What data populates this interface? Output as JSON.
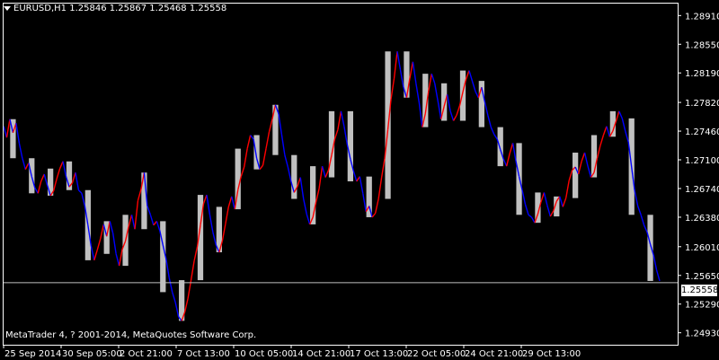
{
  "header": {
    "symbol": "EURUSD,H1",
    "open": "1.25846",
    "high": "1.25867",
    "low": "1.25468",
    "close": "1.25558"
  },
  "copyright": "MetaTrader 4, ? 2001-2014, MetaQuotes Software Corp.",
  "current_price_label": "1.25558",
  "colors": {
    "background": "#000000",
    "frame": "#ffffff",
    "bull_bar": "#ff0000",
    "bear_bar": "#0000ff",
    "bg_box": "#c0c0c0",
    "price_line": "#c0c0c0"
  },
  "chart_data": {
    "type": "line",
    "title": "EURUSD,H1",
    "y_ticks": [
      "1.28910",
      "1.28550",
      "1.28190",
      "1.27820",
      "1.27460",
      "1.27100",
      "1.26740",
      "1.26380",
      "1.26010",
      "1.25650",
      "1.25290",
      "1.24930"
    ],
    "x_ticks": [
      "25 Sep 2014",
      "30 Sep 05:00",
      "2 Oct 21:00",
      "7 Oct 13:00",
      "10 Oct 05:00",
      "14 Oct 21:00",
      "17 Oct 13:00",
      "22 Oct 05:00",
      "24 Oct 21:00",
      "29 Oct 13:00"
    ],
    "ylim": [
      1.2478,
      1.2906
    ],
    "current_price": 1.25558,
    "series": [
      {
        "values": [
          1.2752,
          1.2738,
          1.2761,
          1.2744,
          1.2756,
          1.2731,
          1.2712,
          1.2698,
          1.2706,
          1.2689,
          1.2675,
          1.2668,
          1.2683,
          1.2692,
          1.2678,
          1.2665,
          1.2671,
          1.2686,
          1.2699,
          1.2708,
          1.2689,
          1.2676,
          1.2681,
          1.2694,
          1.2672,
          1.2668,
          1.2652,
          1.2628,
          1.2602,
          1.2584,
          1.2597,
          1.2611,
          1.2629,
          1.2614,
          1.2633,
          1.2618,
          1.2592,
          1.2577,
          1.2598,
          1.2608,
          1.2626,
          1.2641,
          1.2623,
          1.2659,
          1.2673,
          1.2694,
          1.2652,
          1.2641,
          1.2628,
          1.2633,
          1.2621,
          1.2603,
          1.2586,
          1.2562,
          1.2544,
          1.2531,
          1.2513,
          1.2508,
          1.2519,
          1.2536,
          1.2559,
          1.2583,
          1.2601,
          1.2628,
          1.2655,
          1.2666,
          1.2641,
          1.2619,
          1.2603,
          1.2594,
          1.2608,
          1.2629,
          1.2651,
          1.2664,
          1.2648,
          1.2672,
          1.2689,
          1.2701,
          1.2724,
          1.2741,
          1.2736,
          1.2712,
          1.2698,
          1.2703,
          1.2724,
          1.2745,
          1.2761,
          1.2779,
          1.2768,
          1.2742,
          1.2716,
          1.2701,
          1.2683,
          1.2669,
          1.2676,
          1.2688,
          1.2661,
          1.2642,
          1.2629,
          1.2638,
          1.2657,
          1.2674,
          1.2702,
          1.2688,
          1.2697,
          1.2716,
          1.2736,
          1.2748,
          1.2771,
          1.2752,
          1.2729,
          1.2711,
          1.2696,
          1.2683,
          1.2689,
          1.2668,
          1.2645,
          1.2652,
          1.2638,
          1.2643,
          1.2661,
          1.2688,
          1.2712,
          1.2748,
          1.2786,
          1.2812,
          1.2846,
          1.2823,
          1.2801,
          1.2788,
          1.2812,
          1.2833,
          1.2806,
          1.2782,
          1.2751,
          1.2768,
          1.2796,
          1.2818,
          1.2806,
          1.2784,
          1.2761,
          1.2777,
          1.2792,
          1.2771,
          1.2759,
          1.2766,
          1.2778,
          1.2795,
          1.2811,
          1.2822,
          1.2809,
          1.2796,
          1.2788,
          1.2801,
          1.2783,
          1.2766,
          1.2751,
          1.2742,
          1.2736,
          1.2723,
          1.2711,
          1.2702,
          1.2718,
          1.2731,
          1.2708,
          1.2689,
          1.2672,
          1.2654,
          1.2641,
          1.2638,
          1.2631,
          1.2642,
          1.2657,
          1.2669,
          1.2653,
          1.2639,
          1.2646,
          1.2658,
          1.2664,
          1.2651,
          1.2662,
          1.2684,
          1.2697,
          1.2701,
          1.2692,
          1.2708,
          1.2719,
          1.2702,
          1.2688,
          1.2694,
          1.2712,
          1.2728,
          1.2741,
          1.2752,
          1.2739,
          1.2746,
          1.2758,
          1.2771,
          1.2762,
          1.2746,
          1.2732,
          1.2701,
          1.2671,
          1.2652,
          1.2641,
          1.2628,
          1.2619,
          1.2604,
          1.2591,
          1.2572,
          1.2558
        ]
      }
    ]
  }
}
